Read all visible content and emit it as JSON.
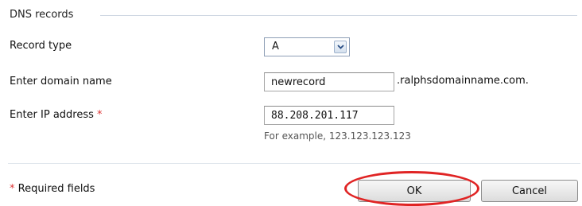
{
  "section": {
    "title": "DNS records"
  },
  "form": {
    "record_type_label": "Record type",
    "record_type_value": "A",
    "domain_label": "Enter domain name",
    "domain_value": "newrecord",
    "domain_suffix": ".ralphsdomainname.com.",
    "ip_label": "Enter IP address",
    "ip_required_marker": "*",
    "ip_value": "88.208.201.117",
    "ip_hint": "For example, 123.123.123.123"
  },
  "footer": {
    "required_marker": "*",
    "required_note": "Required fields",
    "ok_label": "OK",
    "cancel_label": "Cancel"
  },
  "colors": {
    "required_star": "#dd3333",
    "highlight_ellipse": "#e02424"
  },
  "icons": {
    "select_arrow": "chevron-down-icon"
  }
}
